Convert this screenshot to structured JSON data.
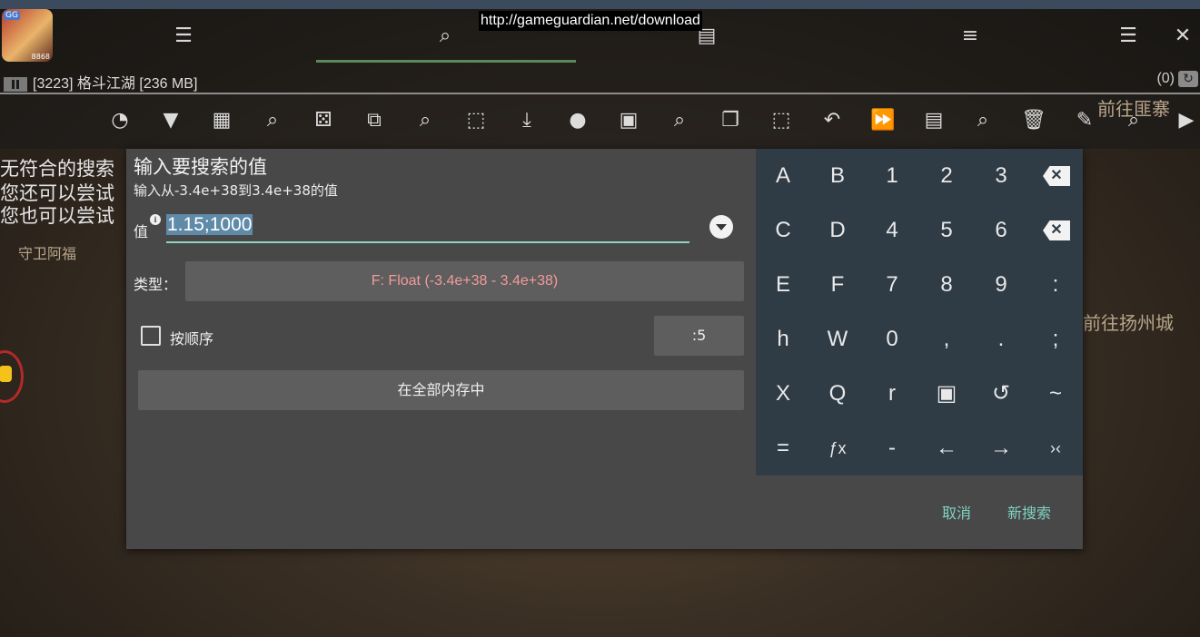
{
  "app": {
    "icon_tag": "GG",
    "icon_number": "8868",
    "url": "http://gameguardian.net/download",
    "process": "[3223] 格斗江湖 [236 MB]",
    "results_count": "(0)"
  },
  "top_icons": [
    "sliders-icon",
    "search-icon",
    "save-icon",
    "list-icon",
    "menu-icon",
    "close-icon"
  ],
  "toolbar_icons": [
    "speed-icon",
    "filter-icon",
    "calculator-icon",
    "search-fuzzy-icon",
    "dice-icon",
    "refresh-box-icon",
    "search-check-icon",
    "select-area-icon",
    "download-icon",
    "record-icon",
    "chip-icon",
    "search-hash-icon",
    "copy-icon",
    "select-all-icon",
    "undo-icon",
    "fast-forward-icon",
    "save-icon",
    "search-question-icon",
    "delete-icon",
    "edit-icon",
    "search-icon",
    "play-icon"
  ],
  "background": {
    "line1": "无符合的搜索",
    "line2": "您还可以尝试",
    "line3": "您也可以尝试",
    "npc_left": "守卫阿福",
    "npc_right1": "前往匪寨",
    "npc_right2": "前往扬州城"
  },
  "dialog": {
    "title": "输入要搜索的值",
    "subtitle": "输入从-3.4e+38到3.4e+38的值",
    "value_label": "值",
    "value": "1.15;1000",
    "type_label": "类型：",
    "type_value": "F: Float (-3.4e+38 - 3.4e+38)",
    "ordered_label": "按顺序",
    "step_value": ":5",
    "region_value": "在全部内存中",
    "cancel": "取消",
    "new_search": "新搜索"
  },
  "keyboard": {
    "rows": [
      [
        "A",
        "B",
        "1",
        "2",
        "3",
        "⌫"
      ],
      [
        "C",
        "D",
        "4",
        "5",
        "6",
        "⌫"
      ],
      [
        "E",
        "F",
        "7",
        "8",
        "9",
        ":"
      ],
      [
        "h",
        "W",
        "0",
        ",",
        ".",
        ";"
      ],
      [
        "X",
        "Q",
        "r",
        "▣",
        "↺",
        "~"
      ],
      [
        "=",
        "ƒx",
        "-",
        "←",
        "→",
        "›‹"
      ]
    ]
  },
  "colors": {
    "dialog_bg": "#484848",
    "keyboard_bg": "#2f3b45",
    "accent": "#7fd3c0",
    "type_text": "#f29a9a"
  }
}
